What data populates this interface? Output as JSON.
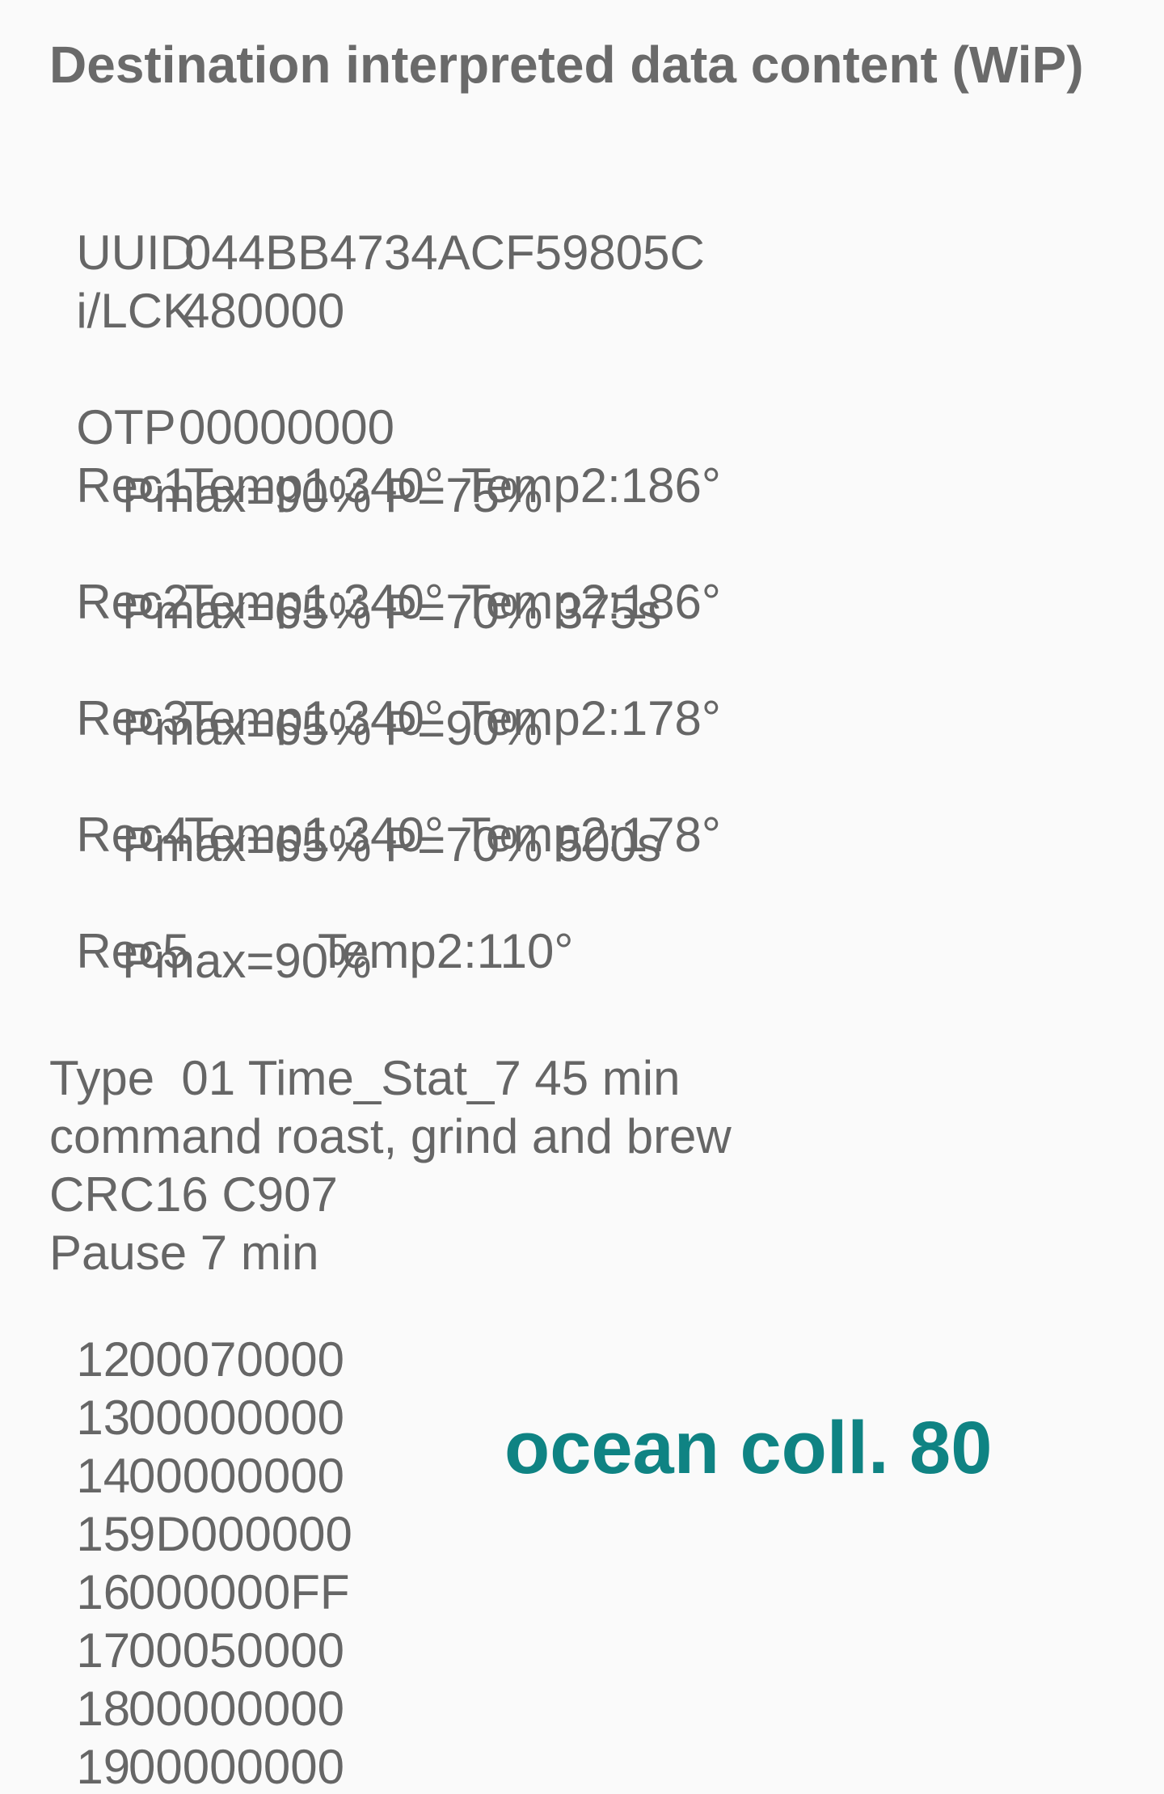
{
  "header": {
    "title": "Destination interpreted data content (WiP)"
  },
  "id_block": {
    "uuid_label": "UUID",
    "uuid_value": "044BB4734ACF59805C",
    "lck_label": "i/LCK",
    "lck_value": "480000"
  },
  "otp": {
    "label": "OTP",
    "value": "00000000"
  },
  "records": [
    {
      "label": "Rec1",
      "temp1": "Temp1:340°",
      "temp2": "Temp2:186°",
      "detail": "Pmax=90% P=75%"
    },
    {
      "label": "Rec2",
      "temp1": "Temp1:340°",
      "temp2": "Temp2:186°",
      "detail": "Pmax=65% P=70% 375s"
    },
    {
      "label": "Rec3",
      "temp1": "Temp1:340°",
      "temp2": "Temp2:178°",
      "detail": "Pmax=65% P=90%"
    },
    {
      "label": "Rec4",
      "temp1": "Temp1:340°",
      "temp2": "Temp2:178°",
      "detail": "Pmax=65% P=70% 500s"
    },
    {
      "label": "Rec5",
      "temp1": "",
      "temp2": "Temp2:110°",
      "detail": "Pmax=90%"
    }
  ],
  "info": {
    "type_line": "Type  01 Time_Stat_7 45 min",
    "command_line": "command roast, grind and brew",
    "crc_line": "CRC16 C907",
    "pause_line": "Pause 7 min"
  },
  "registers": [
    {
      "index": "12",
      "value": "00070000"
    },
    {
      "index": "13",
      "value": "00000000"
    },
    {
      "index": "14",
      "value": "00000000"
    },
    {
      "index": "15",
      "value": "9D000000"
    },
    {
      "index": "16",
      "value": "000000FF"
    },
    {
      "index": "17",
      "value": "00050000"
    },
    {
      "index": "18",
      "value": "00000000"
    },
    {
      "index": "19",
      "value": "00000000"
    }
  ],
  "watermark": {
    "text": "ocean coll. 80",
    "color": "#0f8383"
  }
}
